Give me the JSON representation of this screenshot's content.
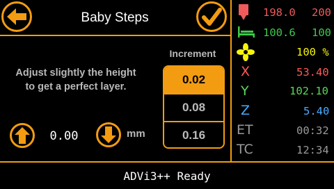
{
  "header": {
    "title": "Baby Steps"
  },
  "main": {
    "instruction_line1": "Adjust slightly the height",
    "instruction_line2": "to get a perfect layer.",
    "offset_value": "0.00",
    "unit": "mm",
    "increment_label": "Increment",
    "increments": [
      "0.02",
      "0.08",
      "0.16"
    ],
    "selected_increment": "0.02"
  },
  "status_panel": {
    "hotend": {
      "current": "198.0",
      "target": "200"
    },
    "bed": {
      "current": "100.6",
      "target": "100"
    },
    "fan": {
      "value": "100 %"
    },
    "x": {
      "label": "X",
      "value": "53.40"
    },
    "y": {
      "label": "Y",
      "value": "102.10"
    },
    "z": {
      "label": "Z",
      "value": "5.40"
    },
    "et": {
      "label": "ET",
      "value": "00:32"
    },
    "tc": {
      "label": "TC",
      "value": "12:34"
    }
  },
  "status_bar": {
    "message": "ADVi3++ Ready"
  },
  "colors": {
    "accent": "#f39c12",
    "hotend": "#ef5a5a",
    "bed": "#3ec94a",
    "fan": "#f5f50a",
    "x": "#ff5a5a",
    "y": "#5bd65b",
    "z": "#4aaaff"
  }
}
